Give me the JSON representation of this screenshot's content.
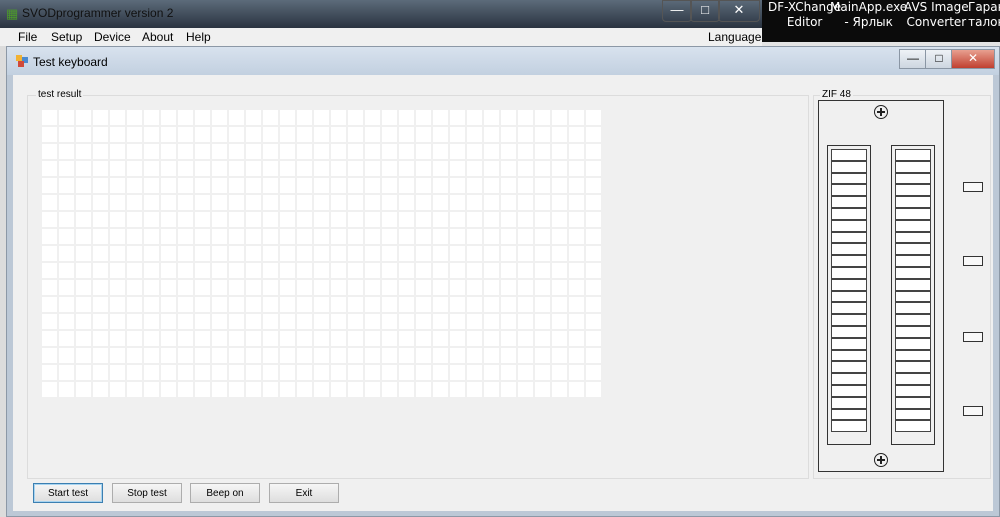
{
  "desktop": {
    "icons": [
      {
        "line1": "DF-XChange",
        "line2": "Editor"
      },
      {
        "line1": "MainApp.exe",
        "line2": "- Ярлык"
      },
      {
        "line1": "AVS Image",
        "line2": "Converter"
      },
      {
        "line1": "Гаран",
        "line2": "талон"
      }
    ]
  },
  "main_window": {
    "title": "SVODprogrammer version 2",
    "menu": [
      "File",
      "Setup",
      "Device",
      "About",
      "Help"
    ],
    "language": "Language"
  },
  "dialog": {
    "title": "Test keyboard",
    "result_label": "test result",
    "zif_label": "ZIF 48",
    "grid": {
      "columns": 33,
      "rows": 17
    },
    "zif_pins_per_side": 24,
    "buttons": {
      "start": "Start test",
      "stop": "Stop test",
      "beep": "Beep on",
      "exit": "Exit"
    }
  },
  "colors": {
    "grid_cell": "#ffffff",
    "panel_bg": "#f0f0f0",
    "close_button": "#c04030"
  }
}
